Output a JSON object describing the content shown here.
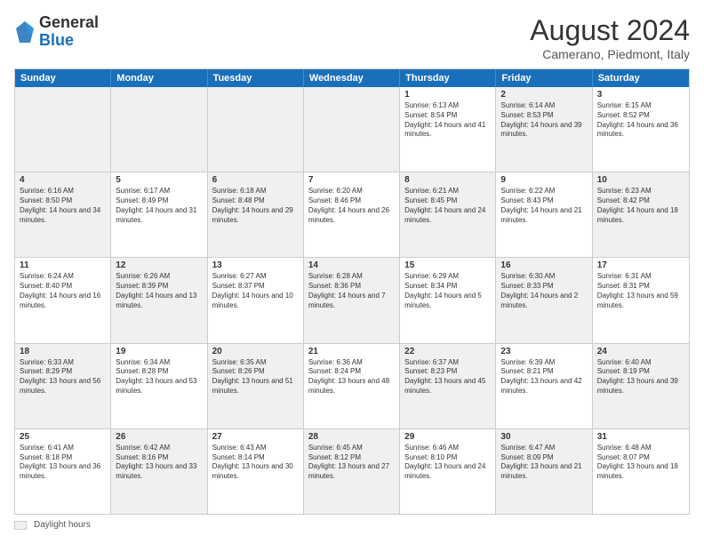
{
  "header": {
    "logo_general": "General",
    "logo_blue": "Blue",
    "month_year": "August 2024",
    "location": "Camerano, Piedmont, Italy"
  },
  "days_of_week": [
    "Sunday",
    "Monday",
    "Tuesday",
    "Wednesday",
    "Thursday",
    "Friday",
    "Saturday"
  ],
  "weeks": [
    [
      {
        "day": "",
        "text": "",
        "shaded": true
      },
      {
        "day": "",
        "text": "",
        "shaded": true
      },
      {
        "day": "",
        "text": "",
        "shaded": true
      },
      {
        "day": "",
        "text": "",
        "shaded": true
      },
      {
        "day": "1",
        "text": "Sunrise: 6:13 AM\nSunset: 8:54 PM\nDaylight: 14 hours and 41 minutes."
      },
      {
        "day": "2",
        "text": "Sunrise: 6:14 AM\nSunset: 8:53 PM\nDaylight: 14 hours and 39 minutes.",
        "shaded": true
      },
      {
        "day": "3",
        "text": "Sunrise: 6:15 AM\nSunset: 8:52 PM\nDaylight: 14 hours and 36 minutes."
      }
    ],
    [
      {
        "day": "4",
        "text": "Sunrise: 6:16 AM\nSunset: 8:50 PM\nDaylight: 14 hours and 34 minutes.",
        "shaded": true
      },
      {
        "day": "5",
        "text": "Sunrise: 6:17 AM\nSunset: 8:49 PM\nDaylight: 14 hours and 31 minutes."
      },
      {
        "day": "6",
        "text": "Sunrise: 6:18 AM\nSunset: 8:48 PM\nDaylight: 14 hours and 29 minutes.",
        "shaded": true
      },
      {
        "day": "7",
        "text": "Sunrise: 6:20 AM\nSunset: 8:46 PM\nDaylight: 14 hours and 26 minutes."
      },
      {
        "day": "8",
        "text": "Sunrise: 6:21 AM\nSunset: 8:45 PM\nDaylight: 14 hours and 24 minutes.",
        "shaded": true
      },
      {
        "day": "9",
        "text": "Sunrise: 6:22 AM\nSunset: 8:43 PM\nDaylight: 14 hours and 21 minutes."
      },
      {
        "day": "10",
        "text": "Sunrise: 6:23 AM\nSunset: 8:42 PM\nDaylight: 14 hours and 18 minutes.",
        "shaded": true
      }
    ],
    [
      {
        "day": "11",
        "text": "Sunrise: 6:24 AM\nSunset: 8:40 PM\nDaylight: 14 hours and 16 minutes."
      },
      {
        "day": "12",
        "text": "Sunrise: 6:26 AM\nSunset: 8:39 PM\nDaylight: 14 hours and 13 minutes.",
        "shaded": true
      },
      {
        "day": "13",
        "text": "Sunrise: 6:27 AM\nSunset: 8:37 PM\nDaylight: 14 hours and 10 minutes."
      },
      {
        "day": "14",
        "text": "Sunrise: 6:28 AM\nSunset: 8:36 PM\nDaylight: 14 hours and 7 minutes.",
        "shaded": true
      },
      {
        "day": "15",
        "text": "Sunrise: 6:29 AM\nSunset: 8:34 PM\nDaylight: 14 hours and 5 minutes."
      },
      {
        "day": "16",
        "text": "Sunrise: 6:30 AM\nSunset: 8:33 PM\nDaylight: 14 hours and 2 minutes.",
        "shaded": true
      },
      {
        "day": "17",
        "text": "Sunrise: 6:31 AM\nSunset: 8:31 PM\nDaylight: 13 hours and 59 minutes."
      }
    ],
    [
      {
        "day": "18",
        "text": "Sunrise: 6:33 AM\nSunset: 8:29 PM\nDaylight: 13 hours and 56 minutes.",
        "shaded": true
      },
      {
        "day": "19",
        "text": "Sunrise: 6:34 AM\nSunset: 8:28 PM\nDaylight: 13 hours and 53 minutes."
      },
      {
        "day": "20",
        "text": "Sunrise: 6:35 AM\nSunset: 8:26 PM\nDaylight: 13 hours and 51 minutes.",
        "shaded": true
      },
      {
        "day": "21",
        "text": "Sunrise: 6:36 AM\nSunset: 8:24 PM\nDaylight: 13 hours and 48 minutes."
      },
      {
        "day": "22",
        "text": "Sunrise: 6:37 AM\nSunset: 8:23 PM\nDaylight: 13 hours and 45 minutes.",
        "shaded": true
      },
      {
        "day": "23",
        "text": "Sunrise: 6:39 AM\nSunset: 8:21 PM\nDaylight: 13 hours and 42 minutes."
      },
      {
        "day": "24",
        "text": "Sunrise: 6:40 AM\nSunset: 8:19 PM\nDaylight: 13 hours and 39 minutes.",
        "shaded": true
      }
    ],
    [
      {
        "day": "25",
        "text": "Sunrise: 6:41 AM\nSunset: 8:18 PM\nDaylight: 13 hours and 36 minutes."
      },
      {
        "day": "26",
        "text": "Sunrise: 6:42 AM\nSunset: 8:16 PM\nDaylight: 13 hours and 33 minutes.",
        "shaded": true
      },
      {
        "day": "27",
        "text": "Sunrise: 6:43 AM\nSunset: 8:14 PM\nDaylight: 13 hours and 30 minutes."
      },
      {
        "day": "28",
        "text": "Sunrise: 6:45 AM\nSunset: 8:12 PM\nDaylight: 13 hours and 27 minutes.",
        "shaded": true
      },
      {
        "day": "29",
        "text": "Sunrise: 6:46 AM\nSunset: 8:10 PM\nDaylight: 13 hours and 24 minutes."
      },
      {
        "day": "30",
        "text": "Sunrise: 6:47 AM\nSunset: 8:09 PM\nDaylight: 13 hours and 21 minutes.",
        "shaded": true
      },
      {
        "day": "31",
        "text": "Sunrise: 6:48 AM\nSunset: 8:07 PM\nDaylight: 13 hours and 18 minutes."
      }
    ]
  ],
  "footer": {
    "legend_label": "Daylight hours"
  }
}
